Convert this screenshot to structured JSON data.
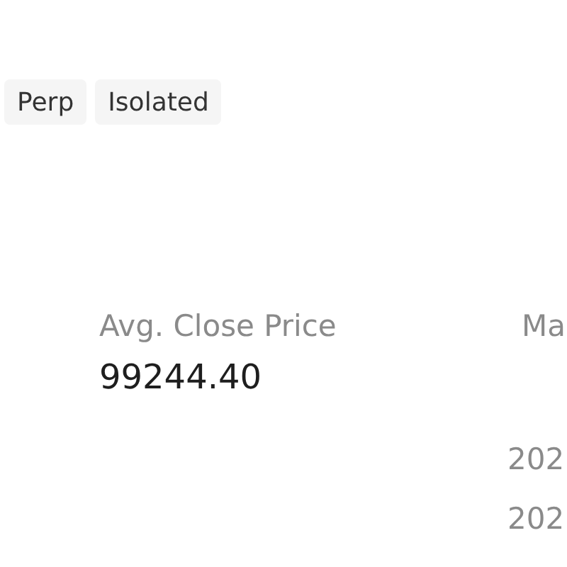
{
  "tags": [
    "Perp",
    "Isolated"
  ],
  "avg_close": {
    "label": "Avg. Close Price",
    "value": "99244.40"
  },
  "column_2": {
    "label": "Ma",
    "rows": [
      "202",
      "202"
    ]
  }
}
